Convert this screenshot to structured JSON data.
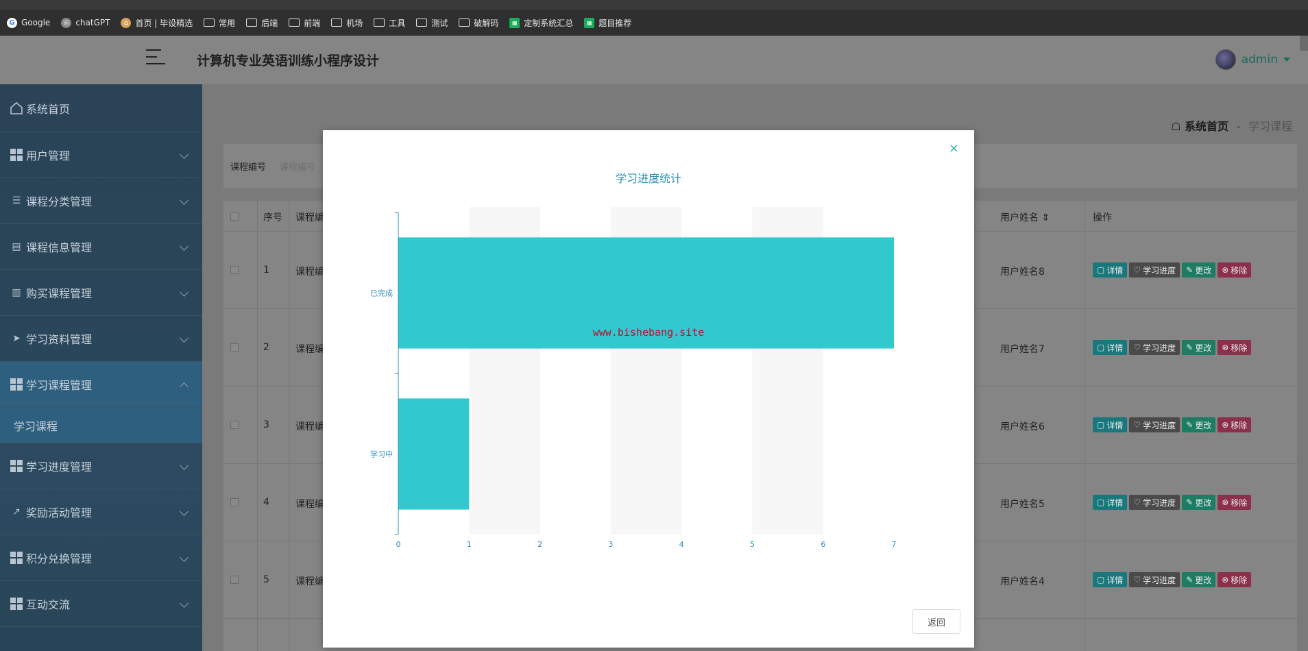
{
  "bookmarks": [
    {
      "icon": "google-icon",
      "label": "Google"
    },
    {
      "icon": "chatgpt-icon",
      "label": "chatGPT"
    },
    {
      "icon": "home-icon",
      "label": "首页 | 毕设精选"
    },
    {
      "icon": "folder-icon",
      "label": "常用"
    },
    {
      "icon": "folder-icon",
      "label": "后端"
    },
    {
      "icon": "folder-icon",
      "label": "前端"
    },
    {
      "icon": "folder-icon",
      "label": "机场"
    },
    {
      "icon": "folder-icon",
      "label": "工具"
    },
    {
      "icon": "folder-icon",
      "label": "测试"
    },
    {
      "icon": "folder-icon",
      "label": "破解码"
    },
    {
      "icon": "sheet-icon",
      "label": "定制系统汇总"
    },
    {
      "icon": "sheet-icon",
      "label": "题目推荐"
    }
  ],
  "header": {
    "title": "计算机专业英语训练小程序设计",
    "user": "admin"
  },
  "sidebar": {
    "home": "系统首页",
    "items": [
      {
        "label": "用户管理"
      },
      {
        "label": "课程分类管理"
      },
      {
        "label": "课程信息管理"
      },
      {
        "label": "购买课程管理"
      },
      {
        "label": "学习资料管理"
      },
      {
        "label": "学习课程管理"
      },
      {
        "label": "学习进度管理"
      },
      {
        "label": "奖励活动管理"
      },
      {
        "label": "积分兑换管理"
      },
      {
        "label": "互动交流"
      }
    ],
    "sub_item": "学习课程"
  },
  "breadcrumb": {
    "home": "系统首页",
    "separator": "-",
    "current": "学习课程"
  },
  "search": {
    "label": "课程编号",
    "placeholder": "课程编号"
  },
  "table": {
    "headers": {
      "index": "序号",
      "course_no": "课程编",
      "user_name": "用户姓名",
      "actions": "操作"
    },
    "rows": [
      {
        "index": "1",
        "course_no": "课程编",
        "user_name": "用户姓名8"
      },
      {
        "index": "2",
        "course_no": "课程编",
        "user_name": "用户姓名7"
      },
      {
        "index": "3",
        "course_no": "课程编",
        "user_name": "用户姓名6"
      },
      {
        "index": "4",
        "course_no": "课程编",
        "user_name": "用户姓名5"
      },
      {
        "index": "5",
        "course_no": "课程编",
        "user_name": "用户姓名4"
      }
    ],
    "actions": {
      "detail": "详情",
      "progress": "学习进度",
      "edit": "更改",
      "delete": "移除"
    }
  },
  "modal": {
    "close": "×",
    "back_button": "返回",
    "watermark": "www.bishebang.site"
  },
  "chart_data": {
    "type": "bar",
    "orientation": "horizontal",
    "title": "学习进度统计",
    "categories": [
      "已完成",
      "学习中"
    ],
    "values": [
      7,
      1
    ],
    "xlim": [
      0,
      7
    ],
    "x_ticks": [
      0,
      1,
      2,
      3,
      4,
      5,
      6,
      7
    ],
    "bar_color": "#31c9cd",
    "axis_color": "#2a8fb7",
    "split_area": true
  }
}
